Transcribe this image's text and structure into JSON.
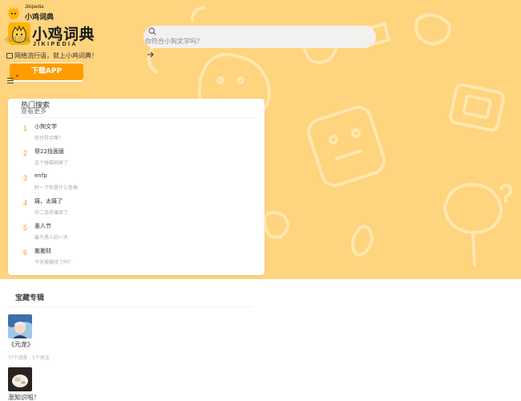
{
  "brand": {
    "mini_latin": "Jikipedia",
    "mini_cn": "小鸡词典",
    "main_cn": "小鸡词典",
    "main_en": "JIKIPEDIA",
    "ghost_text": "小鸡词典",
    "slogan": "网络流行语，就上小鸡词典！"
  },
  "download_button": {
    "label": "下载APP"
  },
  "search": {
    "placeholder": "你符合小狗文学吗？"
  },
  "hot": {
    "title": "热门搜索",
    "more": "查看更多",
    "items": [
      {
        "rank": "1",
        "word": "小狗文学",
        "desc": "你也符合嘛？"
      },
      {
        "rank": "2",
        "word": "帮22找面膜",
        "desc": "这个弹幕刷屏了"
      },
      {
        "rank": "3",
        "word": "enfp",
        "desc": "附一下你是什么性格"
      },
      {
        "rank": "4",
        "word": "痛，太痛了",
        "desc": "中二选手痛哭了"
      },
      {
        "rank": "5",
        "word": "愚人节",
        "desc": "最不愚人的一天"
      },
      {
        "rank": "6",
        "word": "搬搬财",
        "desc": "今天搬搬砖了吗？"
      }
    ]
  },
  "albums": {
    "title": "宝藏专辑",
    "items": [
      {
        "name": "《元龙》",
        "meta": "??个词条 · 5个关注",
        "thumb": "anime-character-thumb"
      },
      {
        "name": "涨知识啦！",
        "meta": "",
        "thumb": "food-photo-thumb"
      }
    ]
  },
  "colors": {
    "hero": "#ffd47e",
    "accent": "#ff9d00",
    "rank": "#ff9a12"
  }
}
